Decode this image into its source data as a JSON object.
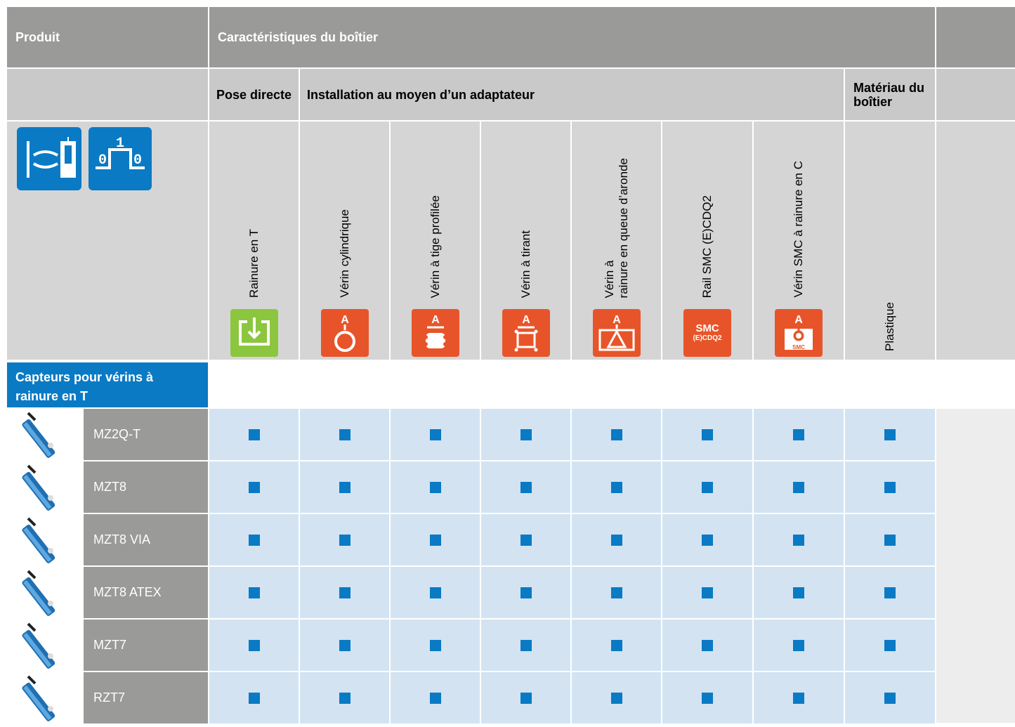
{
  "header": {
    "produit": "Produit",
    "caracteristiques": "Caractéristiques du boîtier"
  },
  "subheader": {
    "pose_directe": "Pose directe",
    "installation": "Installation au moyen d’un adaptateur",
    "materiau": "Matériau du boîtier"
  },
  "columns": [
    {
      "label": "Rainure en T",
      "icon": "t-slot-icon",
      "color": "#8cc63e"
    },
    {
      "label": "Vérin cylindrique",
      "icon": "round-cylinder-icon",
      "color": "#e8542a"
    },
    {
      "label": "Vérin à tige profilée",
      "icon": "profile-rod-icon",
      "color": "#e8542a"
    },
    {
      "label": "Vérin à tirant",
      "icon": "tie-rod-icon",
      "color": "#e8542a"
    },
    {
      "label": "Vérin à",
      "label2": "rainure en queue d’aronde",
      "icon": "dovetail-icon",
      "color": "#e8542a"
    },
    {
      "label": "Rail SMC (E)CDQ2",
      "icon": "smc-ecdq2-icon",
      "badge": "SMC",
      "badge2": "(E)CDQ2",
      "color": "#e8542a"
    },
    {
      "label": "Vérin SMC à rainure en C",
      "icon": "smc-c-slot-icon",
      "badge": "SMC",
      "color": "#e8542a"
    },
    {
      "label": "Plastique"
    }
  ],
  "symbols": {
    "sym1": "magnetic-cylinder-sensor-icon",
    "sym2": "switching-signal-icon",
    "sym2_text": {
      "zero": "0",
      "one": "1"
    },
    "accent": "#0a7ac4"
  },
  "group": {
    "label": "Capteurs pour vérins à rainure en T"
  },
  "products": [
    {
      "name": "MZ2Q-T",
      "marks": [
        true,
        true,
        true,
        true,
        true,
        true,
        true,
        true
      ]
    },
    {
      "name": "MZT8",
      "marks": [
        true,
        true,
        true,
        true,
        true,
        true,
        true,
        true
      ]
    },
    {
      "name": "MZT8 VIA",
      "marks": [
        true,
        true,
        true,
        true,
        true,
        true,
        true,
        true
      ]
    },
    {
      "name": "MZT8 ATEX",
      "marks": [
        true,
        true,
        true,
        true,
        true,
        true,
        true,
        true
      ]
    },
    {
      "name": "MZT7",
      "marks": [
        true,
        true,
        true,
        true,
        true,
        true,
        true,
        true
      ]
    },
    {
      "name": "RZT7",
      "marks": [
        true,
        true,
        true,
        true,
        true,
        true,
        true,
        true
      ]
    }
  ],
  "badge_letter": "A"
}
